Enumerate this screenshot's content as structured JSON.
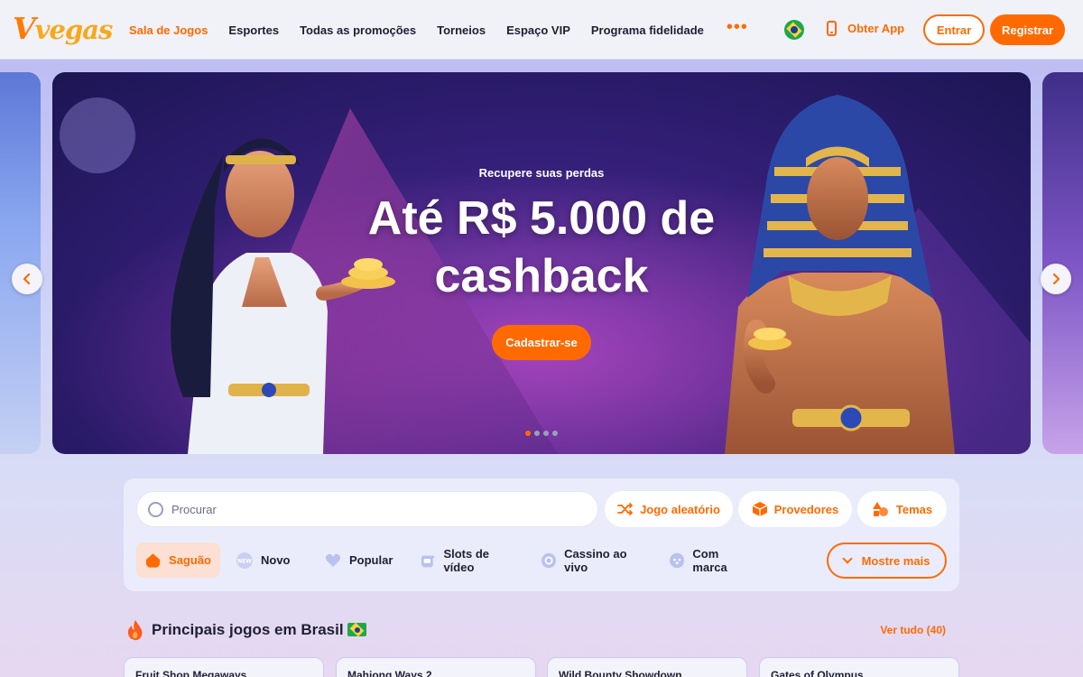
{
  "header": {
    "logo": "Vvegas",
    "nav": [
      {
        "label": "Sala de Jogos",
        "active": true
      },
      {
        "label": "Esportes"
      },
      {
        "label": "Todas as promoções"
      },
      {
        "label": "Torneios"
      },
      {
        "label": "Espaço VIP"
      },
      {
        "label": "Programa fidelidade"
      }
    ],
    "more_label": "•••",
    "language_flag_icon": "brazil-flag-icon",
    "get_app_label": "Obter App",
    "login_label": "Entrar",
    "register_label": "Registrar"
  },
  "banner": {
    "kicker": "Recupere suas perdas",
    "title_line1": "Até R$ 5.000 de",
    "title_line2": "cashback",
    "cta_label": "Cadastrar-se",
    "slides_total": 4,
    "active_slide": 1
  },
  "search": {
    "placeholder": "Procurar",
    "value": "",
    "chips": [
      {
        "label": "Jogo aleatório",
        "icon": "shuffle-icon"
      },
      {
        "label": "Provedores",
        "icon": "box-icon"
      },
      {
        "label": "Temas",
        "icon": "shapes-icon"
      }
    ]
  },
  "categories": [
    {
      "label": "Saguão",
      "icon": "home-icon",
      "active": true
    },
    {
      "label": "Novo",
      "icon": "new-badge-icon"
    },
    {
      "label": "Popular",
      "icon": "heart-icon"
    },
    {
      "label": "Slots de vídeo",
      "icon": "slot-machine-icon"
    },
    {
      "label": "Cassino ao vivo",
      "icon": "live-chip-icon"
    },
    {
      "label": "Com marca",
      "icon": "gamepad-icon"
    }
  ],
  "show_more_label": "Mostre mais",
  "top_games": {
    "title": "Principais jogos em Brasil",
    "see_all": "Ver tudo (40)",
    "games": [
      "Fruit Shop Megaways",
      "Mahjong Ways 2",
      "Wild Bounty Showdown",
      "Gates of Olympus"
    ]
  },
  "colors": {
    "accent": "#ff6a00",
    "header_bg": "#f1f1f8",
    "banner_bg": "#35207a"
  }
}
